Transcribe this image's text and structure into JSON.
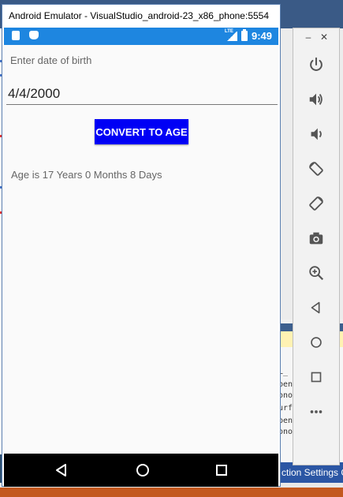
{
  "emulator": {
    "title": "Android Emulator - VisualStudio_android-23_x86_phone:5554"
  },
  "statusbar": {
    "time": "9:49",
    "network_label": "LTE"
  },
  "form": {
    "dob_label": "Enter date of birth",
    "dob_value": "4/4/2000",
    "convert_button": "CONVERT TO AGE",
    "result": "Age is 17 Years 0 Months 8 Days"
  },
  "navbar": {
    "icons": [
      "back-icon",
      "home-icon",
      "recents-icon"
    ]
  },
  "toolbar": {
    "icons": [
      "power-icon",
      "volume-up-icon",
      "volume-down-icon",
      "rotate-left-icon",
      "rotate-right-icon",
      "camera-icon",
      "zoom-icon",
      "back-icon",
      "home-icon",
      "overview-icon",
      "more-icon"
    ]
  },
  "background": {
    "status_text": "ction Settings  G",
    "output_lines": [
      "GL_",
      "Dpen",
      "cono",
      "surf",
      "Dpen",
      "cono"
    ]
  },
  "colors": {
    "statusbar": "#1e86e0",
    "button": "#0000f5",
    "navbar": "#000000"
  }
}
